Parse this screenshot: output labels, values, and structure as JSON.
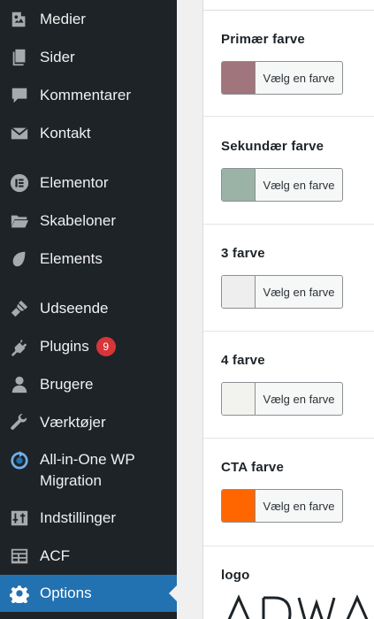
{
  "sidebar": {
    "items": [
      {
        "label": "Medier",
        "icon": "media-icon"
      },
      {
        "label": "Sider",
        "icon": "pages-icon"
      },
      {
        "label": "Kommentarer",
        "icon": "comments-icon"
      },
      {
        "label": "Kontakt",
        "icon": "mail-icon"
      },
      {
        "label": "Elementor",
        "icon": "elementor-icon"
      },
      {
        "label": "Skabeloner",
        "icon": "folder-icon"
      },
      {
        "label": "Elements",
        "icon": "leaf-icon"
      },
      {
        "label": "Udseende",
        "icon": "brush-icon"
      },
      {
        "label": "Plugins",
        "icon": "plugin-icon",
        "badge": "9"
      },
      {
        "label": "Brugere",
        "icon": "user-icon"
      },
      {
        "label": "Værktøjer",
        "icon": "wrench-icon"
      },
      {
        "label": "All-in-One WP",
        "label2": "Migration",
        "icon": "migration-icon"
      },
      {
        "label": "Indstillinger",
        "icon": "settings-icon"
      },
      {
        "label": "ACF",
        "icon": "acf-icon"
      },
      {
        "label": "Options",
        "icon": "gear-icon",
        "active": true
      }
    ]
  },
  "fields": [
    {
      "label": "Primær farve",
      "button": "Vælg en farve",
      "color": "#a0757c"
    },
    {
      "label": "Sekundær farve",
      "button": "Vælg en farve",
      "color": "#9bb2a6"
    },
    {
      "label": "3 farve",
      "button": "Vælg en farve",
      "color": "#eeeeee"
    },
    {
      "label": "4 farve",
      "button": "Vælg en farve",
      "color": "#f2f2ee"
    },
    {
      "label": "CTA farve",
      "button": "Vælg en farve",
      "color": "#ff6600"
    }
  ],
  "logo_field": {
    "label": "logo"
  },
  "colors": {
    "sidebar_bg": "#1d2327",
    "active_bg": "#2271b1",
    "badge_bg": "#d63638"
  }
}
